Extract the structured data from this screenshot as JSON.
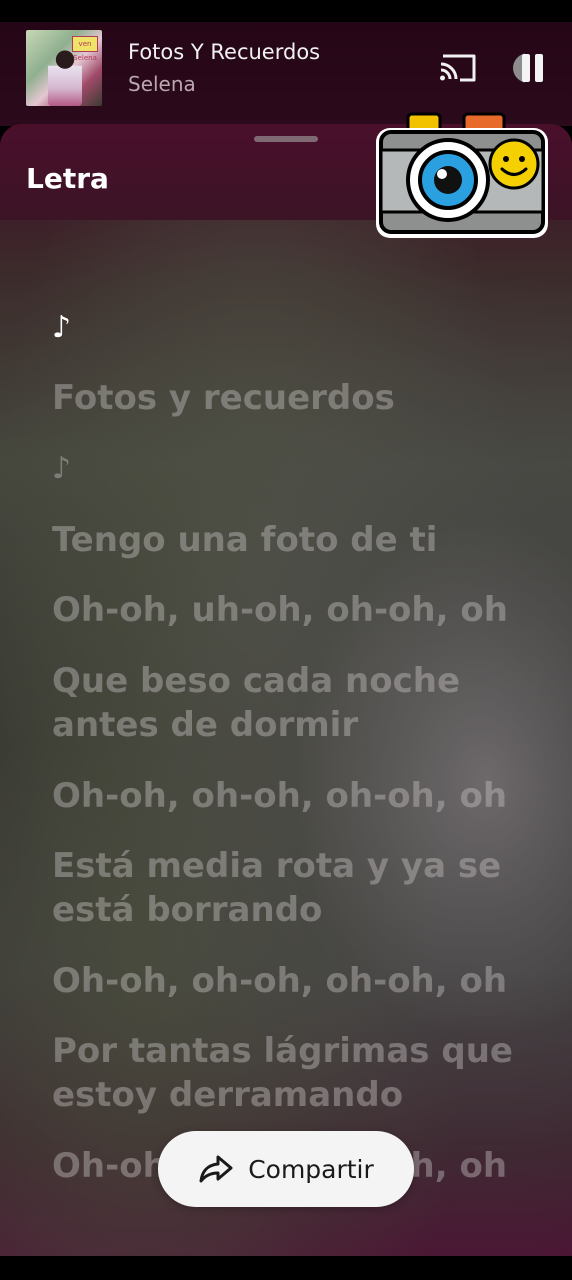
{
  "mini_player": {
    "title": "Fotos Y Recuerdos",
    "artist": "Selena",
    "album_badge": "ven Selena",
    "cast_icon": "cast-icon",
    "pause_icon": "pause-icon"
  },
  "sheet": {
    "title": "Letra",
    "sticker_icon": "camera-smiley-sticker"
  },
  "lyrics": [
    {
      "text": "♪",
      "active": true
    },
    {
      "text": "Fotos y recuerdos"
    },
    {
      "text": "♪"
    },
    {
      "text": "Tengo una foto de ti"
    },
    {
      "text": "Oh-oh, uh-oh, oh-oh, oh"
    },
    {
      "text": "Que beso cada noche antes de dormir"
    },
    {
      "text": "Oh-oh, oh-oh, oh-oh, oh"
    },
    {
      "text": "Está media rota y ya se está borrando"
    },
    {
      "text": "Oh-oh, oh-oh, oh-oh, oh"
    },
    {
      "text": "Por tantas lágrimas que estoy derramando"
    },
    {
      "text": "Oh-oh, oh-oh, oh-oh, oh"
    }
  ],
  "share": {
    "label": "Compartir",
    "icon": "share-arrow-icon"
  },
  "colors": {
    "header_bg": "#4a0f2b",
    "active_lyric": "#ffffff",
    "inactive_lyric": "rgba(200,196,196,0.42)"
  }
}
